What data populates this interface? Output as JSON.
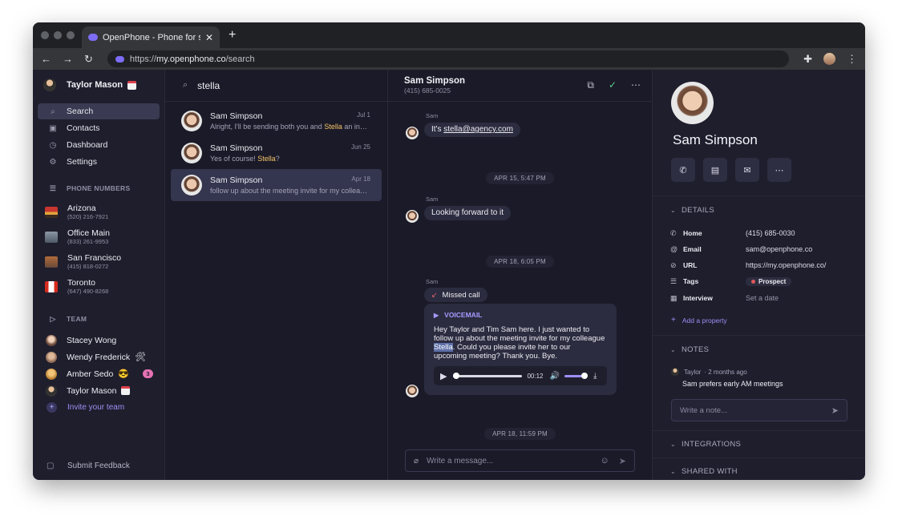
{
  "browser": {
    "tab_title": "OpenPhone - Phone for startups",
    "url_prefix": "https://",
    "url_host": "my.openphone.co",
    "url_path": "/search"
  },
  "sidebar": {
    "user_name": "Taylor Mason",
    "nav": [
      {
        "label": "Search",
        "icon": "search-icon"
      },
      {
        "label": "Contacts",
        "icon": "contacts-icon"
      },
      {
        "label": "Dashboard",
        "icon": "dashboard-icon"
      },
      {
        "label": "Settings",
        "icon": "gear-icon"
      }
    ],
    "phone_numbers_heading": "PHONE NUMBERS",
    "phone_numbers": [
      {
        "name": "Arizona",
        "number": "(520) 216-7921",
        "icon": "arizona-flag-icon"
      },
      {
        "name": "Office Main",
        "number": "(833) 261-9953",
        "icon": "office-building-icon"
      },
      {
        "name": "San Francisco",
        "number": "(415) 818-0272",
        "icon": "san-francisco-icon"
      },
      {
        "name": "Toronto",
        "number": "(647) 490-8268",
        "icon": "canada-flag-icon"
      }
    ],
    "team_heading": "TEAM",
    "team": [
      {
        "name": "Stacey Wong"
      },
      {
        "name": "Wendy Frederick",
        "emoji": "🛠"
      },
      {
        "name": "Amber Sedo",
        "emoji": "😎",
        "badge": "3"
      },
      {
        "name": "Taylor Mason"
      }
    ],
    "invite_label": "Invite your team",
    "feedback_label": "Submit Feedback"
  },
  "search": {
    "query": "stella",
    "results": [
      {
        "name": "Sam Simpson",
        "date": "Jul 1",
        "preview_before": "Alright, I'll be sending both you and ",
        "preview_hl": "Stella",
        "preview_after": " an invite"
      },
      {
        "name": "Sam Simpson",
        "date": "Jun 25",
        "preview_before": "Yes of course! ",
        "preview_hl": "Stella",
        "preview_after": "?"
      },
      {
        "name": "Sam Simpson",
        "date": "Apr 18",
        "preview_before": "follow up about the meeting invite for my colleague",
        "preview_hl": "",
        "preview_after": ""
      }
    ]
  },
  "chat": {
    "contact_name": "Sam Simpson",
    "contact_number": "(415) 685-0025",
    "sender_label": "Sam",
    "msg1_prefix": "It's ",
    "msg1_link": "stella@agency.com",
    "sep1": "APR 15, 5:47 PM",
    "msg2": "Looking forward to it",
    "sep2": "APR 18, 6:05 PM",
    "missed_call": "Missed call",
    "voicemail_label": "VOICEMAIL",
    "vm_before": "Hey Taylor and Tim Sam here. I just wanted to follow up about the meeting invite for my colleague ",
    "vm_sel": "Stella",
    "vm_after": ". Could you please invite her to our upcoming meeting? Thank you. Bye.",
    "vm_time": "00:12",
    "vm_progress": 0,
    "vm_volume": 1,
    "sep3": "APR 18, 11:59 PM",
    "composer_placeholder": "Write a message..."
  },
  "contact": {
    "name": "Sam Simpson",
    "details_heading": "DETAILS",
    "properties": [
      {
        "key": "Home",
        "value": "(415) 685-0030",
        "icon": "phone-icon"
      },
      {
        "key": "Email",
        "value": "sam@openphone.co",
        "icon": "at-icon"
      },
      {
        "key": "URL",
        "value": "https://my.openphone.co/",
        "icon": "link-icon"
      },
      {
        "key": "Tags",
        "value": "Prospect",
        "icon": "list-icon"
      },
      {
        "key": "Interview",
        "value": "Set a date",
        "icon": "calendar-icon"
      }
    ],
    "add_property": "Add a property",
    "notes_heading": "NOTES",
    "note_author": "Taylor",
    "note_time": "· 2 months ago",
    "note_body": "Sam prefers early AM meetings",
    "note_placeholder": "Write a note...",
    "integrations_heading": "INTEGRATIONS",
    "shared_heading": "SHARED WITH"
  }
}
